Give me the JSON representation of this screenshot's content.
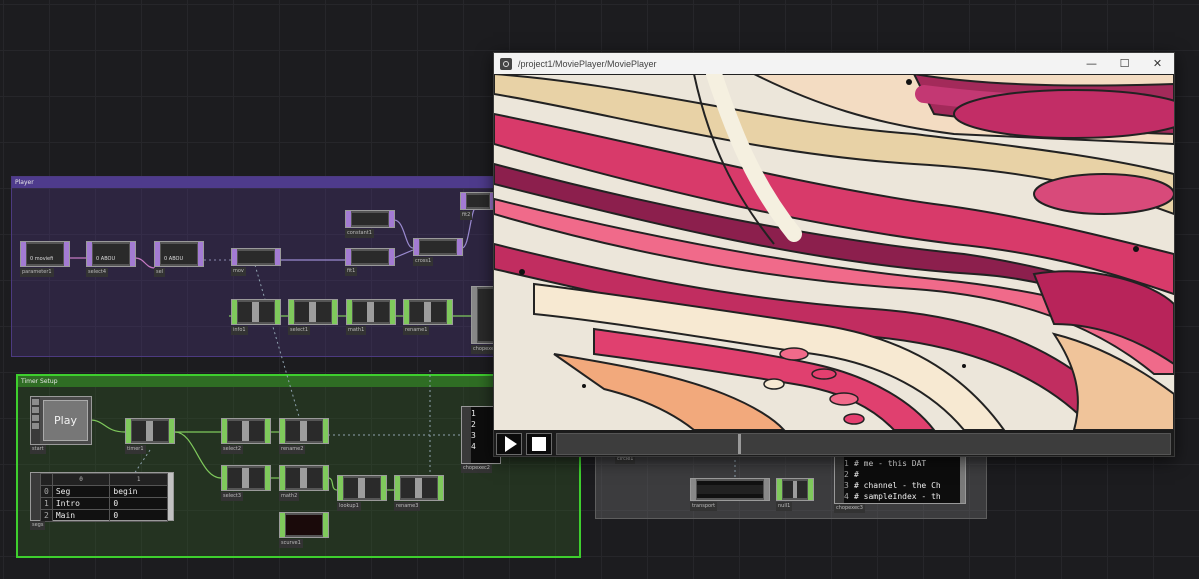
{
  "containers": {
    "player_title": "Player",
    "timer_title": "Timer Setup"
  },
  "nodes": {
    "parameter1": "parameter1",
    "select4": "select4",
    "sel": "sel",
    "mov": "mov",
    "fit1": "fit1",
    "constant1": "constant1",
    "cross1": "cross1",
    "fit2": "fit2",
    "info1": "info1",
    "select1": "select1",
    "math1": "math1",
    "rename1": "rename1",
    "chopexec": "chopexec",
    "start": "start",
    "timer1": "timer1",
    "select2": "select2",
    "rename2": "rename2",
    "select3": "select3",
    "math2": "math2",
    "lookup1": "lookup1",
    "rename3": "rename3",
    "scurve1": "scurve1",
    "segs": "segs",
    "chopexec2": "chopexec2",
    "circle1": "circle1",
    "transport": "transport",
    "null1": "null1",
    "chopexec3": "chopexec3"
  },
  "play_button": {
    "label": "Play"
  },
  "segs_table": {
    "header": [
      "0",
      "1"
    ],
    "rows": [
      {
        "idx": "0",
        "c0": "Seg",
        "c1": "begin"
      },
      {
        "idx": "1",
        "c0": "Intro",
        "c1": "0"
      },
      {
        "idx": "2",
        "c0": "Main",
        "c1": "0"
      }
    ]
  },
  "chopexec2_lines": [
    "1",
    "2",
    "3",
    "4"
  ],
  "chopexec3_lines": [
    {
      "n": "1",
      "t": "# me - this DAT"
    },
    {
      "n": "2",
      "t": "#"
    },
    {
      "n": "3",
      "t": "# channel - the Ch"
    },
    {
      "n": "4",
      "t": "# sampleIndex - th"
    }
  ],
  "viewer": {
    "title": "/project1/MoviePlayer/MoviePlayer",
    "minimize": "—",
    "maximize": "☐",
    "close": "✕"
  },
  "colors": {
    "background": "#1c1c1f",
    "player_container": "#4e3b8c",
    "timer_container": "#3ecf2e",
    "top_operator": "#a37bd3",
    "chop_operator": "#7fc95c"
  }
}
